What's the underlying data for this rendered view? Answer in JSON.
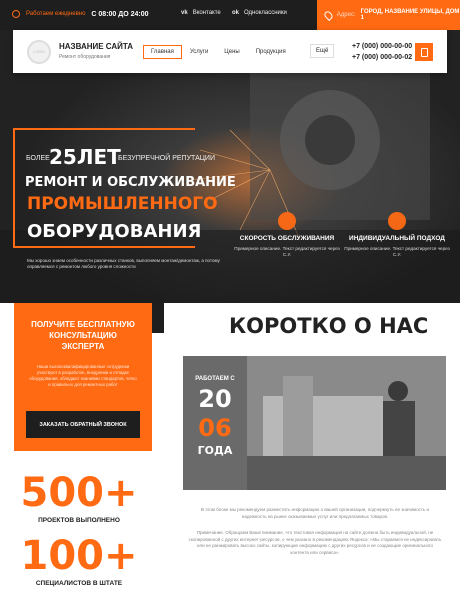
{
  "topbar": {
    "hours_label": "Работаем ежедневно",
    "hours_value": "С 08:00 ДО 24:00",
    "vk": "Вконтакте",
    "ok": "Одноклассники",
    "address_label": "Адрес:",
    "address_value": "ГОРОД, НАЗВАНИЕ УЛИЦЫ, ДОМ 1"
  },
  "header": {
    "logo": "LOGO",
    "site_name": "НАЗВАНИЕ САЙТА",
    "site_sub": "Ремонт оборудования",
    "nav": [
      "Главная",
      "Услуги",
      "Цены",
      "Продукция"
    ],
    "more": "Ещё",
    "phone1": "+7 (000) 000-00-00",
    "phone2": "+7 (000) 000-00-02"
  },
  "hero": {
    "more": "БОЛЕЕ",
    "years": "25ЛЕТ",
    "reputation": "БЕЗУПРЕЧНОЙ РЕПУТАЦИИ",
    "line1": "РЕМОНТ И ОБСЛУЖИВАНИЕ",
    "line2": "ПРОМЫШЛЕННОГО",
    "line3": "ОБОРУДОВАНИЯ",
    "text": "Мы хорошо знаем особенности различных станков, выполняем монтаж/демонтаж, а потому оправляемся с ремонтом любого уровня сложности",
    "features": [
      {
        "title": "СКОРОСТЬ ОБСЛУЖИВАНИЯ",
        "desc": "Примерное описание. Текст редактируется через С.У."
      },
      {
        "title": "ИНДИВИДУАЛЬНЫЙ ПОДХОД",
        "desc": "Примерное описание. Текст редактируется через С.У."
      }
    ]
  },
  "cta": {
    "title": "ПОЛУЧИТЕ БЕСПЛАТНУЮ КОНСУЛЬТАЦИЮ ЭКСПЕРТА",
    "desc": "Наши высококвалифицированные сотрудники участвуют в разработке, внедрении и отладке оборудования, обладают знаниями стандартов, четко и правильно для ремонтных работ",
    "button": "ЗАКАЗАТЬ ОБРАТНЫЙ ЗВОНОК"
  },
  "about": {
    "title": "КОРОТКО О НАС",
    "since_label": "РАБОТАЕМ С",
    "since_1": "20",
    "since_2": "06",
    "since_3": "ГОДА",
    "p1": "В этом блоке мы рекомендуем разместить информацию о вашей организации, подчеркнуть ее значимость и надежность на рынке оказываемых услуг или предлагаемых товаров.",
    "p2": "Примечание. Обращаем Ваше внимание, что текстовая информация на сайте должна быть индивидуальной, не скопированной с других интернет-ресурсов, о чем указано в рекомендациях Яндекса: «Мы стараемся не индексировать или не ранжировать высоко сайты, копирующие информацию с других ресурсов и не создающие оригинального контента или сервиса»."
  },
  "stats": [
    {
      "value": "500+",
      "label": "ПРОЕКТОВ ВЫПОЛНЕНО"
    },
    {
      "value": "100+",
      "label": "СПЕЦИАЛИСТОВ В ШТАТЕ"
    }
  ],
  "colors": {
    "accent": "#ff6a13",
    "dark": "#1e1e1e"
  }
}
